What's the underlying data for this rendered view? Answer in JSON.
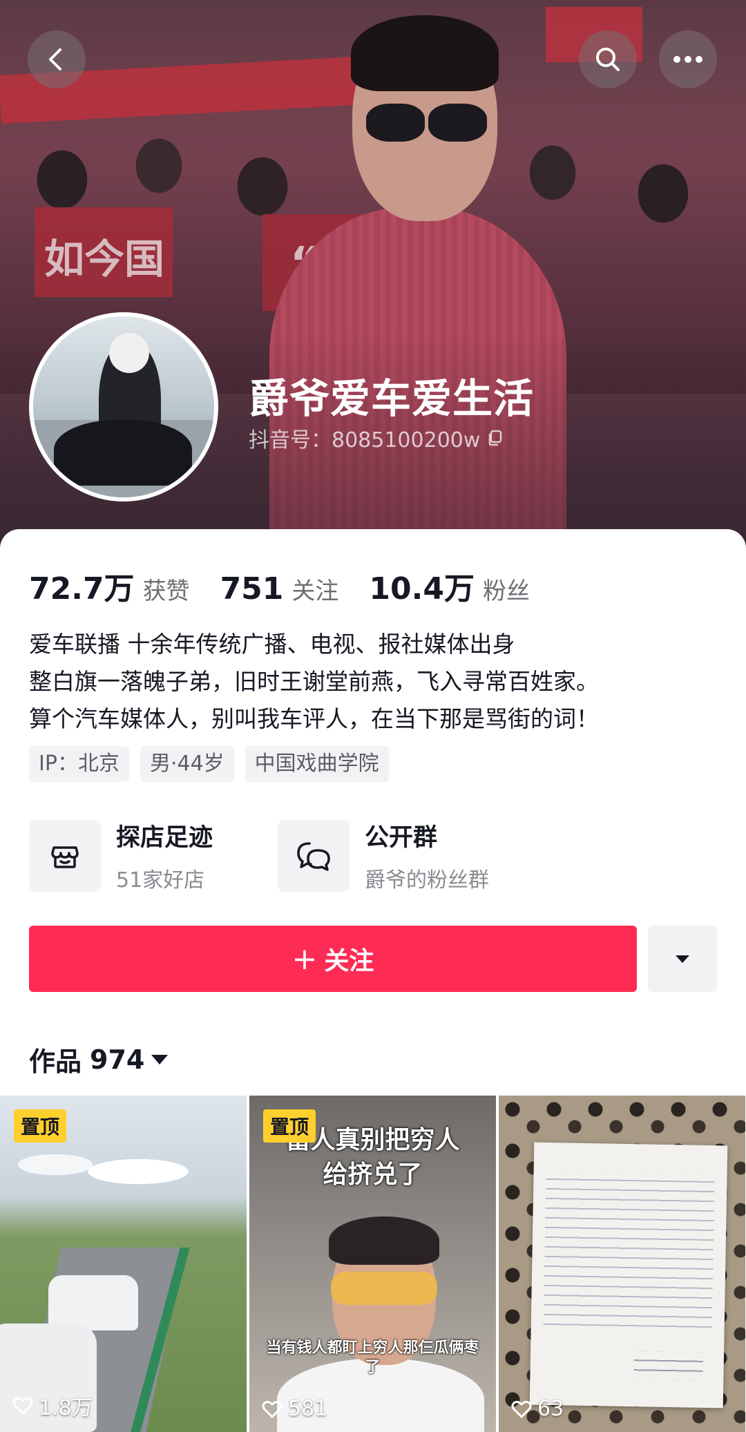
{
  "header": {
    "nickname": "爵爷爱车爱生活",
    "douyin_id": "抖音号：8085100200w"
  },
  "cover_texts": {
    "banner_left": "如今国",
    "banner_mid": "“日”"
  },
  "stats": [
    {
      "num": "72.7万",
      "label": "获赞"
    },
    {
      "num": "751",
      "label": "关注"
    },
    {
      "num": "10.4万",
      "label": "粉丝"
    }
  ],
  "bio": [
    "爱车联播 十余年传统广播、电视、报社媒体出身",
    "整白旗一落魄子弟，旧时王谢堂前燕，飞入寻常百姓家。",
    "算个汽车媒体人，别叫我车评人，在当下那是骂街的词！"
  ],
  "tags": [
    "IP：北京",
    "男·44岁",
    "中国戏曲学院"
  ],
  "shortcuts": [
    {
      "title": "探店足迹",
      "sub": "51家好店",
      "icon": "shop-icon"
    },
    {
      "title": "公开群",
      "sub": "爵爷的粉丝群",
      "icon": "chat-icon"
    }
  ],
  "follow": {
    "label": "关注",
    "plus": "+"
  },
  "works": {
    "label": "作品",
    "count": "974"
  },
  "videos": [
    {
      "pinned": "置顶",
      "likes": "1.8万"
    },
    {
      "pinned": "置顶",
      "likes": "581",
      "headline_1": "富人真别把穷人",
      "headline_2": "给挤兑了",
      "subtitle_1": "当有钱人都盯上穷人那仨瓜俩枣",
      "subtitle_2": "了"
    },
    {
      "pinned": "",
      "likes": "63"
    }
  ],
  "colors": {
    "accent": "#fe2c55",
    "pin": "#ffcf2e",
    "text": "#161823",
    "secondary": "#6e6f75"
  }
}
